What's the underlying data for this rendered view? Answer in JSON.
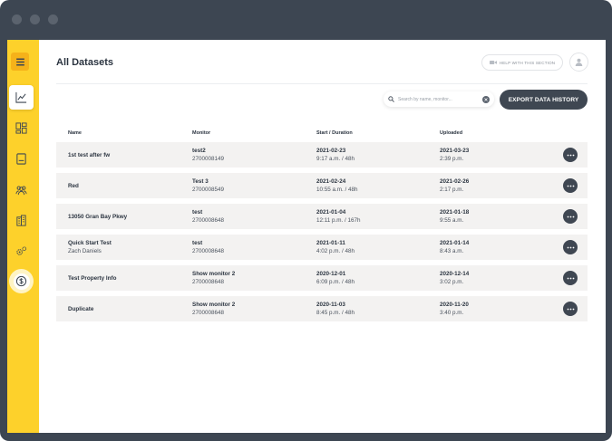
{
  "window": {
    "titlebar_dots": 3
  },
  "sidebar": {
    "items": [
      {
        "icon": "menu-icon"
      },
      {
        "icon": "chart-line-icon",
        "active": true
      },
      {
        "icon": "dashboard-grid-icon"
      },
      {
        "icon": "monitor-device-icon"
      },
      {
        "icon": "users-group-icon"
      },
      {
        "icon": "building-icon"
      },
      {
        "icon": "settings-gears-icon"
      },
      {
        "icon": "dollar-circle-icon"
      }
    ],
    "accent": "#fdd12b"
  },
  "header": {
    "title": "All Datasets",
    "help_label": "HELP WITH THIS SECTION"
  },
  "toolbar": {
    "search_placeholder": "Search by name, monitor...",
    "search_value": "",
    "export_label": "EXPORT DATA HISTORY"
  },
  "table": {
    "columns": [
      "Name",
      "Monitor",
      "Start / Duration",
      "Uploaded"
    ],
    "rows": [
      {
        "name": "1st test after fw",
        "name_sub": "",
        "monitor": "test2",
        "monitor_id": "2700008149",
        "start": "2021-02-23",
        "duration": "9:17 a.m. / 48h",
        "uploaded": "2021-03-23",
        "uploaded_time": "2:39 p.m."
      },
      {
        "name": "Red",
        "name_sub": "",
        "monitor": "Test 3",
        "monitor_id": "2700008549",
        "start": "2021-02-24",
        "duration": "10:55 a.m. / 48h",
        "uploaded": "2021-02-26",
        "uploaded_time": "2:17 p.m."
      },
      {
        "name": "13050 Gran Bay Pkwy",
        "name_sub": "",
        "monitor": "test",
        "monitor_id": "2700008648",
        "start": "2021-01-04",
        "duration": "12:11 p.m. / 167h",
        "uploaded": "2021-01-18",
        "uploaded_time": "9:55 a.m."
      },
      {
        "name": "Quick Start Test",
        "name_sub": "Zach Daniels",
        "monitor": "test",
        "monitor_id": "2700008648",
        "start": "2021-01-11",
        "duration": "4:02 p.m. / 48h",
        "uploaded": "2021-01-14",
        "uploaded_time": "8:43 a.m."
      },
      {
        "name": "Test Property Info",
        "name_sub": "",
        "monitor": "Show monitor 2",
        "monitor_id": "2700008648",
        "start": "2020-12-01",
        "duration": "6:09 p.m. / 48h",
        "uploaded": "2020-12-14",
        "uploaded_time": "3:02 p.m."
      },
      {
        "name": "Duplicate",
        "name_sub": "",
        "monitor": "Show monitor 2",
        "monitor_id": "2700008648",
        "start": "2020-11-03",
        "duration": "8:45 p.m. / 48h",
        "uploaded": "2020-11-20",
        "uploaded_time": "3:40 p.m."
      }
    ]
  },
  "colors": {
    "frame": "#3d4652",
    "accent_yellow": "#fdd12b",
    "dark_button": "#3f4752",
    "row_bg": "#f3f2f1"
  }
}
